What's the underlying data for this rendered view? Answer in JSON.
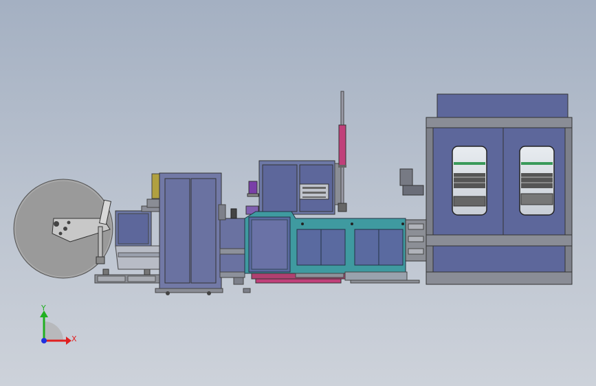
{
  "viewport": {
    "background_top": "#a4b0c2",
    "background_bottom": "#cdd2da"
  },
  "triad": {
    "x_label": "X",
    "y_label": "Y",
    "x_color": "#e02020",
    "y_color": "#20b020",
    "z_color": "#2030e0"
  },
  "colors": {
    "machine_blue": "#6d78a6",
    "panel_blue": "#5d679b",
    "frame_grey": "#7d808a",
    "teal": "#3f9aa0",
    "magenta": "#c0407a",
    "olive": "#b0a040",
    "purple": "#7a3fa8",
    "reel_grey": "#9a9a9a"
  }
}
